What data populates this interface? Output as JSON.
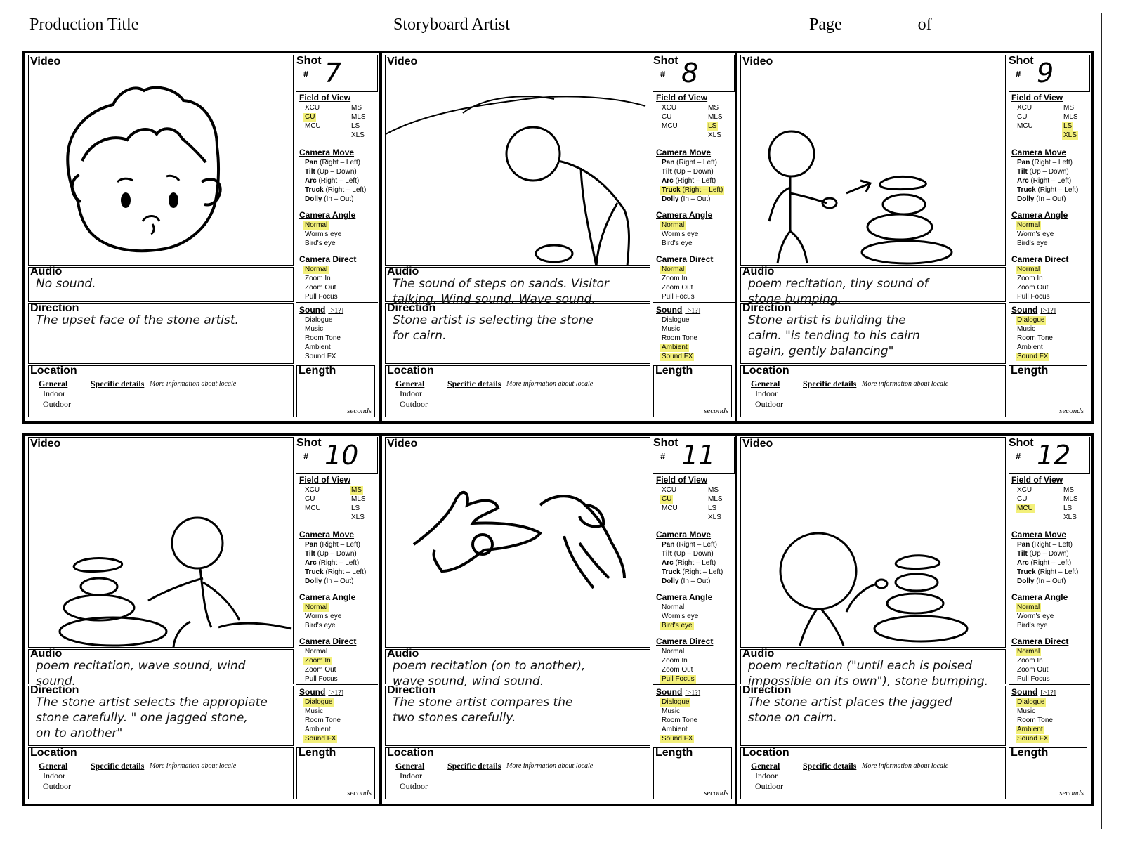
{
  "header": {
    "production_title": "Production Title",
    "storyboard_artist": "Storyboard Artist",
    "page": "Page",
    "of": "of"
  },
  "labels": {
    "video": "Video",
    "shot": "Shot",
    "hash": "#",
    "field_of_view": "Field of View",
    "camera_move": "Camera Move",
    "camera_angle": "Camera Angle",
    "camera_direct": "Camera Direct",
    "sound": "Sound",
    "sound_hint": "[>1?]",
    "audio": "Audio",
    "direction": "Direction",
    "location": "Location",
    "length": "Length",
    "general": "General",
    "specific_details": "Specific details",
    "more_info": "More information about locale",
    "indoor": "Indoor",
    "outdoor": "Outdoor",
    "seconds": "seconds"
  },
  "options": {
    "fov": [
      "XCU",
      "MS",
      "CU",
      "MLS",
      "MCU",
      "LS",
      "XLS"
    ],
    "move": [
      "Pan (Right – Left)",
      "Tilt (Up – Down)",
      "Arc (Right – Left)",
      "Truck (Right – Left)",
      "Dolly (In – Out)"
    ],
    "angle": [
      "Normal",
      "Worm's eye",
      "Bird's eye"
    ],
    "direct": [
      "Normal",
      "Zoom In",
      "Zoom Out",
      "Pull Focus"
    ],
    "sound": [
      "Dialogue",
      "Music",
      "Room Tone",
      "Ambient",
      "Sound FX"
    ]
  },
  "panels": [
    {
      "shot": "7",
      "audio": "No sound.",
      "direction": "The upset face of the stone artist.",
      "highlight": {
        "fov": [
          "CU"
        ],
        "move": [],
        "angle": [
          "Normal"
        ],
        "direct": [
          "Normal"
        ],
        "sound": []
      },
      "drawing": "face"
    },
    {
      "shot": "8",
      "audio": "The sound of steps on sands. Visitor\ntalking. Wind sound. Wave sound.",
      "direction": "Stone artist is selecting the stone\nfor cairn.",
      "highlight": {
        "fov": [
          "LS"
        ],
        "move": [
          "Truck (Right – Left)"
        ],
        "angle": [
          "Normal"
        ],
        "direct": [
          "Normal"
        ],
        "sound": [
          "Ambient",
          "Sound FX"
        ]
      },
      "drawing": "bend"
    },
    {
      "shot": "9",
      "audio": "poem recitation, tiny sound of\nstone bumping.",
      "direction": "Stone artist is building the\ncairn. \"is tending to his cairn\nagain, gently balancing\"",
      "highlight": {
        "fov": [
          "LS",
          "XLS"
        ],
        "move": [],
        "angle": [
          "Normal"
        ],
        "direct": [
          "Normal"
        ],
        "sound": [
          "Dialogue",
          "Sound FX"
        ]
      },
      "drawing": "build"
    },
    {
      "shot": "10",
      "audio": "poem recitation, wave sound, wind\nsound.",
      "direction": "The stone artist selects the appropiate\nstone carefully. \" one jagged stone,\non to another\"",
      "highlight": {
        "fov": [
          "MS"
        ],
        "move": [],
        "angle": [
          "Normal"
        ],
        "direct": [
          "Zoom In"
        ],
        "sound": [
          "Dialogue",
          "Sound FX"
        ]
      },
      "drawing": "sit"
    },
    {
      "shot": "11",
      "audio": "poem recitation (on to another),\nwave sound, wind sound.",
      "direction": "The stone artist compares the\ntwo stones carefully.",
      "highlight": {
        "fov": [
          "CU"
        ],
        "move": [],
        "angle": [
          "Bird's eye"
        ],
        "direct": [
          "Pull Focus"
        ],
        "sound": [
          "Dialogue",
          "Sound FX"
        ]
      },
      "drawing": "hands"
    },
    {
      "shot": "12",
      "audio": "poem recitation (\"until each is poised\nimpossible on its own\"), stone bumping.",
      "direction": "The stone artist places the jagged\nstone on cairn.",
      "highlight": {
        "fov": [
          "MCU"
        ],
        "move": [],
        "angle": [
          "Normal"
        ],
        "direct": [
          "Normal"
        ],
        "sound": [
          "Dialogue",
          "Ambient",
          "Sound FX"
        ]
      },
      "drawing": "place"
    }
  ]
}
